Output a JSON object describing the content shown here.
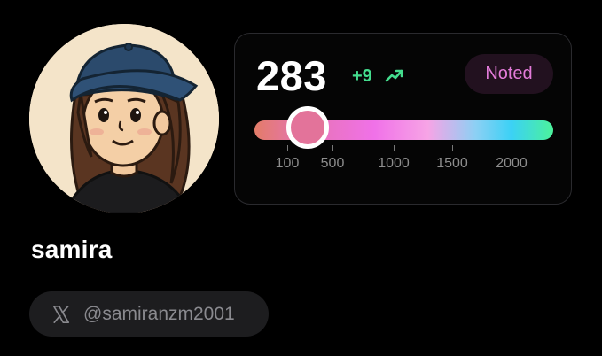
{
  "profile": {
    "username": "samira",
    "handle": "@samiranzm2001",
    "platform_icon": "x-logo-icon"
  },
  "score_card": {
    "score": "283",
    "delta": "+9",
    "trend_icon": "trend-up-icon",
    "badge_label": "Noted",
    "slider": {
      "value": 283,
      "min": 100,
      "max": 2300,
      "ticks": [
        "100",
        "500",
        "1000",
        "1500",
        "2000"
      ]
    }
  },
  "colors": {
    "background": "#000000",
    "delta_green": "#44dd8e",
    "badge_text": "#e37bd9",
    "thumb": "#e3739a"
  }
}
